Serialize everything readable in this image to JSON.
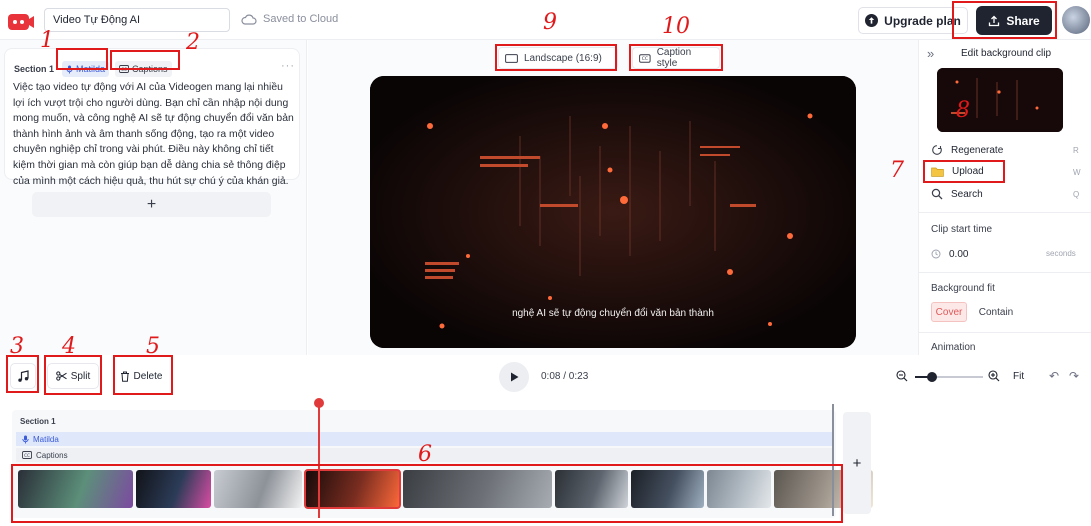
{
  "header": {
    "project_title": "Video Tự Động AI",
    "saved_status": "Saved to Cloud",
    "upgrade_label": "Upgrade plan",
    "share_label": "Share"
  },
  "script_panel": {
    "section_label": "Section 1",
    "voice_chip": "Matilda",
    "caption_chip": "Captions",
    "more": "···",
    "text": "Việc tạo video tự động với AI của Videogen mang lại nhiều lợi ích vượt trội cho người dùng. Bạn chỉ cần nhập nội dung mong muốn, và công nghệ AI sẽ tự động chuyển đổi văn bản thành hình ảnh và âm thanh sống động, tạo ra một video chuyên nghiệp chỉ trong vài phút. Điều này không chỉ tiết kiệm thời gian mà còn giúp bạn dễ dàng chia sẻ thông điệp của mình một cách hiệu quả, thu hút sự chú ý của khán giả.",
    "add_section": "+"
  },
  "preview": {
    "landscape_label": "Landscape (16:9)",
    "caption_style_label": "Caption style",
    "subtitle": "nghệ AI sẽ tự động chuyển đổi văn bản thành"
  },
  "right_panel": {
    "collapse": "»",
    "title": "Edit background clip",
    "regenerate": "Regenerate",
    "regenerate_key": "R",
    "upload": "Upload",
    "upload_key": "W",
    "search": "Search",
    "search_key": "Q",
    "clip_start_label": "Clip start time",
    "clip_start_value": "0.00",
    "clip_start_unit": "seconds",
    "bg_fit_label": "Background fit",
    "fit_cover": "Cover",
    "fit_contain": "Contain",
    "animation_label": "Animation"
  },
  "controls": {
    "split_label": "Split",
    "delete_label": "Delete",
    "time": "0:08 / 0:23",
    "zoom_level": 0.25,
    "fit_label": "Fit"
  },
  "timeline": {
    "section_label": "Section 1",
    "voice_track": "Matilda",
    "caption_track": "Captions",
    "add_clip": "+",
    "playhead_fraction": 0.348,
    "clips": [
      {
        "name": "clip-1",
        "selected": false
      },
      {
        "name": "clip-2",
        "selected": false
      },
      {
        "name": "clip-3",
        "selected": false
      },
      {
        "name": "clip-4",
        "selected": true
      },
      {
        "name": "clip-5",
        "selected": false
      },
      {
        "name": "clip-6",
        "selected": false
      },
      {
        "name": "clip-7",
        "selected": false
      },
      {
        "name": "clip-8",
        "selected": false
      },
      {
        "name": "clip-9",
        "selected": false
      }
    ]
  },
  "annotations": [
    "1",
    "2",
    "3",
    "4",
    "5",
    "6",
    "7",
    "8",
    "9",
    "10"
  ],
  "colors": {
    "accent_red": "#e0191b",
    "dark": "#1f2430",
    "voice_blue": "#3a5bd9"
  }
}
